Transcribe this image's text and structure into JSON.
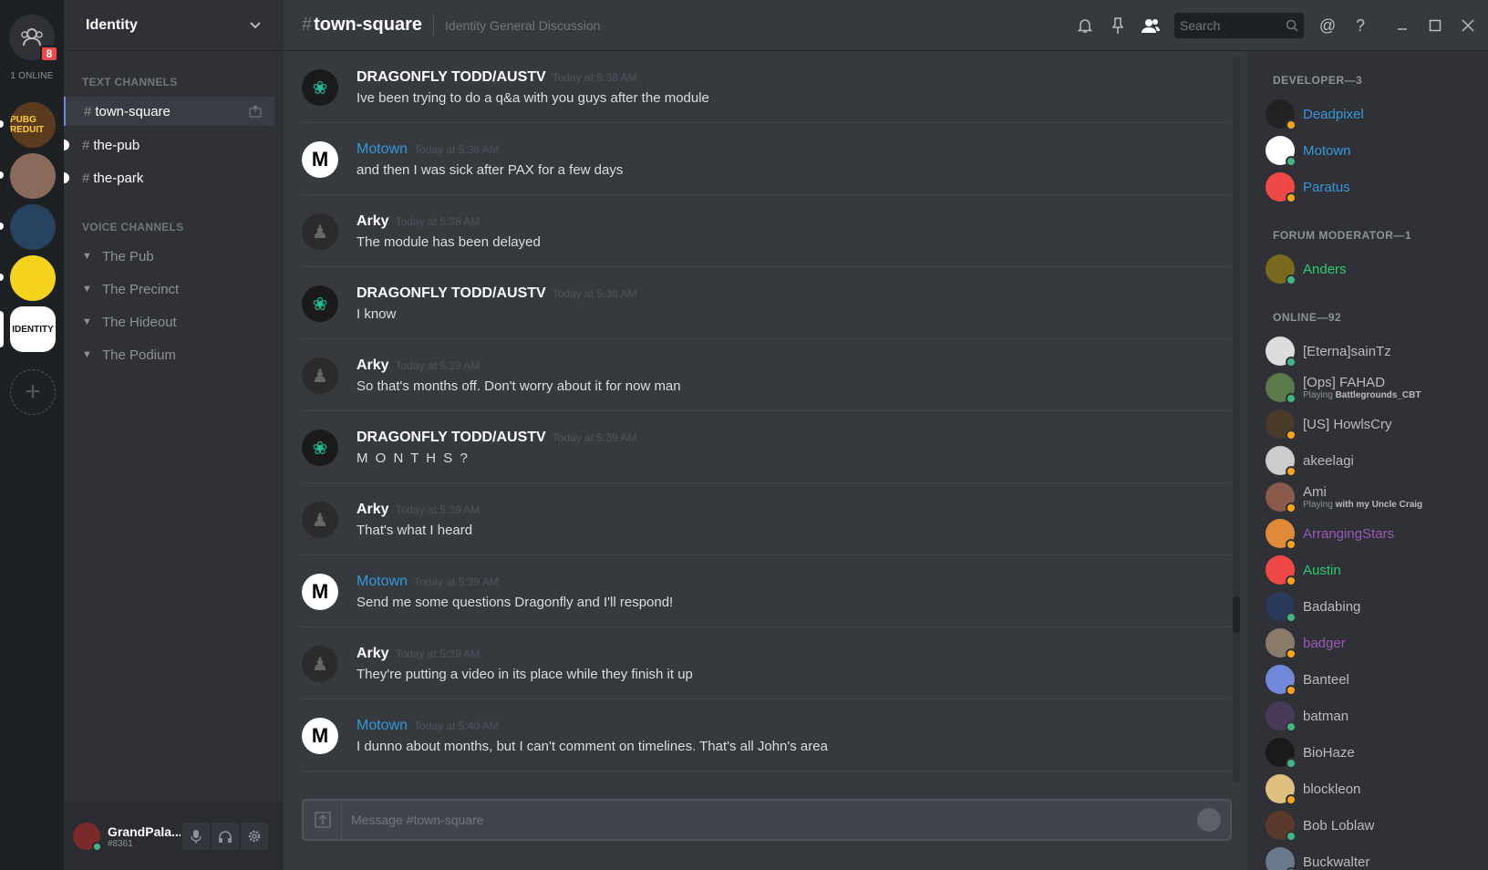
{
  "colors": {
    "accent": "#7289da",
    "link_blue": "#3498db",
    "online": "#43b581",
    "idle": "#faa61a",
    "mod_green": "#2ecc71",
    "purple": "#9b59b6",
    "badge_red": "#f04747"
  },
  "guilds": {
    "friends_badge": "8",
    "online_label": "1 ONLINE",
    "items": [
      {
        "name": "PUBG server",
        "label": "PUBG REDUIT",
        "bg": "#5a3b1e",
        "fg": "#ffcc33"
      },
      {
        "name": "Photo server",
        "label": "",
        "bg": "#8a6a5a",
        "fg": "#fff"
      },
      {
        "name": "Globe server",
        "label": "",
        "bg": "#27435f",
        "fg": "#9fd2ff"
      },
      {
        "name": "Cartoon server",
        "label": "",
        "bg": "#f5d21c",
        "fg": "#333"
      },
      {
        "name": "Identity server",
        "label": "IDENTITY",
        "bg": "#ffffff",
        "fg": "#111"
      }
    ],
    "add_label": "+"
  },
  "server": {
    "name": "Identity",
    "text_category": "TEXT CHANNELS",
    "text_channels": [
      "town-square",
      "the-pub",
      "the-park"
    ],
    "voice_category": "VOICE CHANNELS",
    "voice_channels": [
      "The Pub",
      "The Precinct",
      "The Hideout",
      "The Podium"
    ]
  },
  "user": {
    "name": "GrandPala...",
    "discriminator": "#8361"
  },
  "header": {
    "channel": "town-square",
    "topic": "Identity General Discussion",
    "search_placeholder": "Search"
  },
  "messages": [
    {
      "author": "DRAGONFLY TODD/AUSTV",
      "time": "Today at 5:38 AM",
      "text": "Ive been trying to do a q&a with you guys after the module",
      "avatar": "dragonfly",
      "style": "white"
    },
    {
      "author": "Motown",
      "time": "Today at 5:38 AM",
      "text": "and then I was sick after PAX for a few days",
      "avatar": "motown",
      "style": "blue"
    },
    {
      "author": "Arky",
      "time": "Today at 5:38 AM",
      "text": "The module has been delayed",
      "avatar": "arky",
      "style": "white"
    },
    {
      "author": "DRAGONFLY TODD/AUSTV",
      "time": "Today at 5:38 AM",
      "text": "I know",
      "avatar": "dragonfly",
      "style": "white"
    },
    {
      "author": "Arky",
      "time": "Today at 5:39 AM",
      "text": "So that's months off. Don't worry about it for now man",
      "avatar": "arky",
      "style": "white"
    },
    {
      "author": "DRAGONFLY TODD/AUSTV",
      "time": "Today at 5:39 AM",
      "text": "M O N T H S ?",
      "avatar": "dragonfly",
      "style": "white"
    },
    {
      "author": "Arky",
      "time": "Today at 5:39 AM",
      "text": "That's what I heard",
      "avatar": "arky",
      "style": "white"
    },
    {
      "author": "Motown",
      "time": "Today at 5:39 AM",
      "text": "Send me some questions Dragonfly and I'll respond!",
      "avatar": "motown",
      "style": "blue"
    },
    {
      "author": "Arky",
      "time": "Today at 5:39 AM",
      "text": "They're putting a video in its place while they finish it up",
      "avatar": "arky",
      "style": "white"
    },
    {
      "author": "Motown",
      "time": "Today at 5:40 AM",
      "text": "I dunno about months, but I can't comment on timelines. That's all John's area",
      "avatar": "motown",
      "style": "blue"
    }
  ],
  "composer": {
    "placeholder": "Message #town-square"
  },
  "members": {
    "categories": [
      {
        "label": "DEVELOPER—3",
        "members": [
          {
            "name": "Deadpixel",
            "color": "#3498db",
            "status": "idle",
            "av": "#222"
          },
          {
            "name": "Motown",
            "color": "#3498db",
            "status": "online",
            "av": "#fff"
          },
          {
            "name": "Paratus",
            "color": "#3498db",
            "status": "idle",
            "av": "#f04747"
          }
        ]
      },
      {
        "label": "FORUM MODERATOR—1",
        "members": [
          {
            "name": "Anders",
            "color": "#2ecc71",
            "status": "online",
            "av": "#7a6a20"
          }
        ]
      },
      {
        "label": "ONLINE—92",
        "members": [
          {
            "name": "[Eterna]sainTz",
            "color": "#b9bbbe",
            "status": "online",
            "av": "#ddd"
          },
          {
            "name": "[Ops] FAHAD",
            "color": "#b9bbbe",
            "status": "online",
            "av": "#5a7a4a",
            "game_prefix": "Playing ",
            "game": "Battlegrounds_CBT"
          },
          {
            "name": "[US] HowlsCry",
            "color": "#b9bbbe",
            "status": "idle",
            "av": "#4a3a2a"
          },
          {
            "name": "akeelagi",
            "color": "#b9bbbe",
            "status": "idle",
            "av": "#ccc"
          },
          {
            "name": "Ami",
            "color": "#b9bbbe",
            "status": "idle",
            "av": "#8a5a4a",
            "game_prefix": "Playing ",
            "game": "with my Uncle Craig"
          },
          {
            "name": "ArrangingStars",
            "color": "#9b59b6",
            "status": "idle",
            "av": "#e08a3a"
          },
          {
            "name": "Austin",
            "color": "#2ecc71",
            "status": "idle",
            "av": "#f04747"
          },
          {
            "name": "Badabing",
            "color": "#b9bbbe",
            "status": "online",
            "av": "#2a3a5a"
          },
          {
            "name": "badger",
            "color": "#9b59b6",
            "status": "idle",
            "av": "#8a7a6a"
          },
          {
            "name": "Banteel",
            "color": "#b9bbbe",
            "status": "idle",
            "av": "#7289da"
          },
          {
            "name": "batman",
            "color": "#b9bbbe",
            "status": "online",
            "av": "#4a3a5a"
          },
          {
            "name": "BioHaze",
            "color": "#b9bbbe",
            "status": "online",
            "av": "#1a1a1a"
          },
          {
            "name": "blockleon",
            "color": "#b9bbbe",
            "status": "idle",
            "av": "#e0c080"
          },
          {
            "name": "Bob Loblaw",
            "color": "#b9bbbe",
            "status": "online",
            "av": "#5a3a2a"
          },
          {
            "name": "Buckwalter",
            "color": "#b9bbbe",
            "status": "online",
            "av": "#6a7a8a"
          }
        ]
      }
    ]
  },
  "icons": {
    "bell": "bell-icon",
    "pin": "pin-icon",
    "members": "members-icon",
    "search": "search-icon",
    "mention": "at-icon",
    "help": "help-icon",
    "minimize": "minimize-icon",
    "maximize": "maximize-icon",
    "close": "close-icon",
    "mic": "mic-icon",
    "headset": "headset-icon",
    "settings": "gear-icon"
  },
  "text_labels": {
    "mention": "@",
    "help": "?"
  }
}
